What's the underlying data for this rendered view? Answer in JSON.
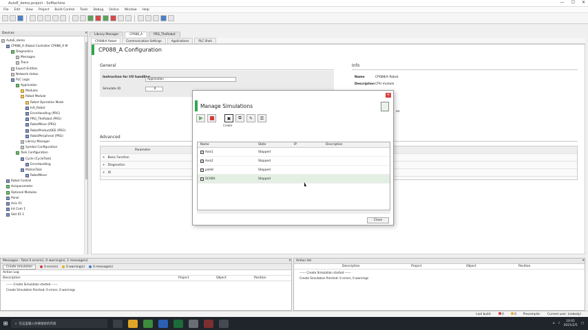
{
  "window": {
    "title": "AutoE_demo.project - SoMachine",
    "controls": [
      "—",
      "☐",
      "✕"
    ]
  },
  "menu": [
    "File",
    "Edit",
    "View",
    "Project",
    "Build Control",
    "Tools",
    "Debug",
    "Online",
    "Window",
    "Help"
  ],
  "devices_panel": {
    "title": "Devices",
    "items": [
      {
        "label": "AutoE_demo",
        "indent": 0,
        "icon": "p"
      },
      {
        "label": "CP088_A (Robot Controller CP088_A M",
        "indent": 1,
        "icon": "b"
      },
      {
        "label": "Diagnostics",
        "indent": 2,
        "icon": "g"
      },
      {
        "label": "Messages",
        "indent": 3,
        "icon": "p"
      },
      {
        "label": "Trace",
        "indent": 3,
        "icon": "p"
      },
      {
        "label": "Export Entities",
        "indent": 2,
        "icon": "p"
      },
      {
        "label": "Network status",
        "indent": 2,
        "icon": "p"
      },
      {
        "label": "PLC Logic",
        "indent": 2,
        "icon": "b"
      },
      {
        "label": "Application",
        "indent": 3,
        "icon": "g"
      },
      {
        "label": "Modules",
        "indent": 4,
        "icon": "f"
      },
      {
        "label": "Robot Module",
        "indent": 4,
        "icon": "f"
      },
      {
        "label": "Robot Operation Mode",
        "indent": 5,
        "icon": "f"
      },
      {
        "label": "Init_Robot",
        "indent": 5,
        "icon": "b"
      },
      {
        "label": "ErrorHandling (PRG)",
        "indent": 5,
        "icon": "b"
      },
      {
        "label": "PRG_TheRobot (PRG)",
        "indent": 5,
        "icon": "b"
      },
      {
        "label": "RobotMove (PRG)",
        "indent": 5,
        "icon": "b"
      },
      {
        "label": "RobotProductOEE (PRG)",
        "indent": 5,
        "icon": "b"
      },
      {
        "label": "RobotPeripheral (PRG)",
        "indent": 5,
        "icon": "b"
      },
      {
        "label": "Library Manager",
        "indent": 4,
        "icon": "p"
      },
      {
        "label": "Symbol Configuration",
        "indent": 4,
        "icon": "p"
      },
      {
        "label": "Task Configuration",
        "indent": 3,
        "icon": "g"
      },
      {
        "label": "Cycle (CycleTask)",
        "indent": 4,
        "icon": "b"
      },
      {
        "label": "ErrorHandling",
        "indent": 5,
        "icon": "b"
      },
      {
        "label": "MotionTask",
        "indent": 4,
        "icon": "b"
      },
      {
        "label": "RobotMove",
        "indent": 5,
        "icon": "b"
      },
      {
        "label": "Robot Control",
        "indent": 1,
        "icon": "b"
      },
      {
        "label": "Axisparameter",
        "indent": 1,
        "icon": "g"
      },
      {
        "label": "Optional Modules",
        "indent": 1,
        "icon": "g"
      },
      {
        "label": "Panel",
        "indent": 1,
        "icon": "b"
      },
      {
        "label": "Axis X1",
        "indent": 1,
        "icon": "b"
      },
      {
        "label": "Int Com 1",
        "indent": 1,
        "icon": "b"
      },
      {
        "label": "Slot 01 1",
        "indent": 1,
        "icon": "b"
      }
    ]
  },
  "doc_tabs": [
    {
      "label": "Library Manager",
      "active": false
    },
    {
      "label": "CP088_A",
      "active": true
    },
    {
      "label": "PRG_TheRobot",
      "active": false
    }
  ],
  "sub_tabs": [
    {
      "label": "CP088/A Robot",
      "active": true
    },
    {
      "label": "Communication Settings",
      "active": false
    },
    {
      "label": "Applications",
      "active": false
    },
    {
      "label": "PLC Shell",
      "active": false
    }
  ],
  "config": {
    "title": "CP088_A Configuration",
    "general_label": "General",
    "info_label": "Info",
    "field_instr": "Instruction for I/O handling",
    "field_instr_value": "Application",
    "field_sim": "Simulate IO",
    "field_sim_value": "0",
    "info_name_k": "Name",
    "info_name_v": "CP088/A Robot",
    "info_desc_k": "Description",
    "info_desc_v": "CPU module",
    "info_extra": "on",
    "advanced_label": "Advanced",
    "adv_col": "Parameter",
    "adv_rows": [
      "Basic Function",
      "Diagnostics",
      "IO"
    ]
  },
  "dialog": {
    "title": "Manage Simulations",
    "close": "✕",
    "create_label": "Create",
    "columns": [
      "Name",
      "State",
      "IP",
      "Description"
    ],
    "rows": [
      {
        "name": "Axis1",
        "state": "Stopped",
        "ip": "",
        "desc": "",
        "selected": false
      },
      {
        "name": "Axis2",
        "state": "Stopped",
        "ip": "",
        "desc": "",
        "selected": false
      },
      {
        "name": "pallet",
        "state": "Stopped",
        "ip": "",
        "desc": "",
        "selected": false
      },
      {
        "name": "SCARA",
        "state": "Stopped",
        "ip": "",
        "desc": "",
        "selected": true
      }
    ],
    "close_button": "Close"
  },
  "messages": {
    "title": "Messages - Total 0 error(s), 0 warning(s), 1 message(s)",
    "filter": "Create simulation",
    "errors": "0 error(s)",
    "warnings": "0 warning(s)",
    "msgs": "0 message(s)",
    "cols": [
      "Description",
      "Project",
      "Object",
      "Position"
    ],
    "section": "Action Log",
    "lines": [
      "------ Create Simulation started ------",
      "Create Simulation finished: 0 errors, 0 warnings"
    ]
  },
  "output": {
    "title": "Action list",
    "cols": [
      "Description",
      "Project",
      "Object",
      "Position"
    ],
    "lines": [
      "------ Create Simulation started ------",
      "Create Simulation finished: 0 errors, 0 warnings"
    ]
  },
  "statusbar": {
    "last_build": "Last build:",
    "err": "0",
    "warn": "0",
    "precompile": "Precompile:",
    "user": "Current user: (nobody)"
  },
  "taskbar": {
    "search": "在这里输入你要搜索的内容",
    "time": "10:01",
    "date": "2021/2/5"
  },
  "colors": {
    "accent_green": "#2fa84f",
    "taskbar": "#20252b",
    "error_red": "#d23c3c"
  }
}
